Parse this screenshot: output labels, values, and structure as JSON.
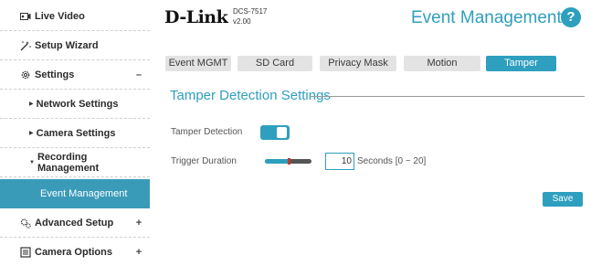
{
  "sidebar": {
    "live_video": "Live Video",
    "setup_wizard": "Setup Wizard",
    "settings": "Settings",
    "settings_toggle": "–",
    "network_settings": "Network Settings",
    "camera_settings": "Camera Settings",
    "recording_management": "Recording Management",
    "event_management": "Event Management",
    "advanced_setup": "Advanced Setup",
    "advanced_toggle": "+",
    "camera_options": "Camera Options",
    "camera_options_toggle": "+"
  },
  "header": {
    "logo": "D-Link",
    "model": "DCS-7517",
    "version": "v2.00",
    "page_title": "Event Management",
    "help": "?"
  },
  "tabs": {
    "event_mgmt": "Event MGMT",
    "sd_card": "SD Card",
    "privacy_mask": "Privacy Mask",
    "motion": "Motion",
    "tamper": "Tamper"
  },
  "section": {
    "title": "Tamper Detection Settings",
    "tamper_detection_label": "Tamper Detection",
    "tamper_detection_enabled": true,
    "trigger_duration_label": "Trigger Duration",
    "trigger_duration_value": "10",
    "trigger_duration_min": 0,
    "trigger_duration_max": 20,
    "trigger_duration_hint": "Seconds [0 ~ 20]"
  },
  "actions": {
    "save": "Save"
  },
  "colors": {
    "accent": "#2e9fbe",
    "active_nav": "#3a9bb8",
    "tab_inactive": "#e3e3e3"
  }
}
